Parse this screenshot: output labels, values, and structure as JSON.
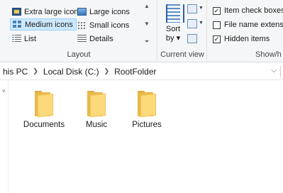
{
  "ribbon": {
    "layout": {
      "group_label": "Layout",
      "items": [
        {
          "label": "Extra large icons",
          "icon": "extra-large-icons-icon",
          "selected": false
        },
        {
          "label": "Large icons",
          "icon": "large-icons-icon",
          "selected": false
        },
        {
          "label": "Medium icons",
          "icon": "medium-icons-icon",
          "selected": true
        },
        {
          "label": "Small icons",
          "icon": "small-icons-icon",
          "selected": false
        },
        {
          "label": "List",
          "icon": "list-icon",
          "selected": false
        },
        {
          "label": "Details",
          "icon": "details-icon",
          "selected": false
        }
      ]
    },
    "current_view": {
      "group_label": "Current view",
      "sort_label_line1": "Sort",
      "sort_label_line2": "by"
    },
    "show_hide": {
      "group_label": "Show/h",
      "item_check_boxes": {
        "label": "Item check boxes",
        "checked": true
      },
      "file_name_extensions": {
        "label": "File name extensio",
        "checked": false
      },
      "hidden_items": {
        "label": "Hidden items",
        "checked": true
      }
    }
  },
  "address": {
    "crumbs": [
      "his PC",
      "Local Disk (C:)",
      "RootFolder"
    ]
  },
  "folders": [
    {
      "name": "Documents",
      "icon": "folder-icon"
    },
    {
      "name": "Music",
      "icon": "folder-icon"
    },
    {
      "name": "Pictures",
      "icon": "folder-icon"
    }
  ],
  "colors": {
    "selection_bg": "#cce8ff",
    "selection_border": "#99d1ff",
    "folder_yellow": "#fcd97a",
    "ribbon_bg": "#f5f6f7"
  }
}
